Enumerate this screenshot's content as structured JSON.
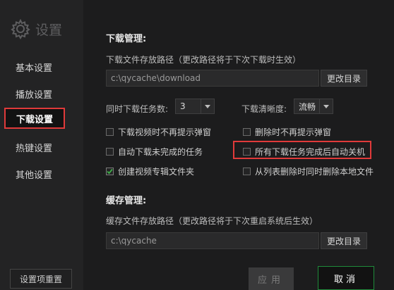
{
  "sidebar": {
    "title": "设置",
    "items": [
      {
        "label": "基本设置"
      },
      {
        "label": "播放设置"
      },
      {
        "label": "下载设置"
      },
      {
        "label": "热键设置"
      },
      {
        "label": "其他设置"
      }
    ],
    "reset_label": "设置项重置"
  },
  "download": {
    "section_title": "下载管理:",
    "path_label": "下载文件存放路径（更改路径将于下次下载时生效）",
    "path_value": "c:\\qycache\\download",
    "change_label": "更改目录",
    "concurrent_label": "同时下载任务数:",
    "concurrent_value": "3",
    "quality_label": "下载清晰度:",
    "quality_value": "流畅",
    "options": [
      {
        "label": "下载视频时不再提示弹窗",
        "checked": false
      },
      {
        "label": "删除时不再提示弹窗",
        "checked": false
      },
      {
        "label": "自动下载未完成的任务",
        "checked": false
      },
      {
        "label": "所有下载任务完成后自动关机",
        "checked": false
      },
      {
        "label": "创建视频专辑文件夹",
        "checked": true
      },
      {
        "label": "从列表删除时同时删除本地文件",
        "checked": false
      }
    ]
  },
  "cache": {
    "section_title": "缓存管理:",
    "path_label": "缓存文件存放路径（更改路径将于下次重启系统后生效）",
    "path_value": "c:\\qycache",
    "change_label": "更改目录"
  },
  "footer": {
    "apply_label": "应用",
    "cancel_label": "取消"
  },
  "colors": {
    "accent_green": "#1f8b3a",
    "highlight_red": "#e03a3a",
    "check_green": "#3fae49"
  }
}
